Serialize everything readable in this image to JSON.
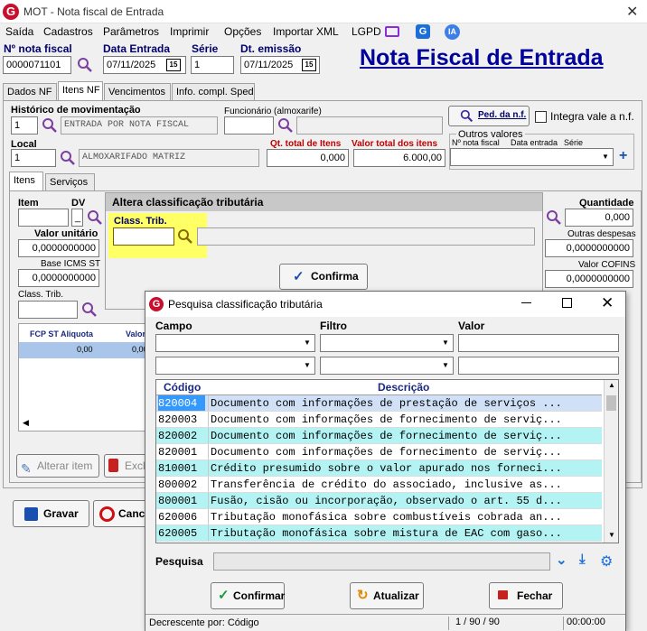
{
  "window": {
    "title": "MOT - Nota fiscal de Entrada",
    "logo_letter": "G"
  },
  "menu": [
    "Saída",
    "Cadastros",
    "Parâmetros",
    "Imprimir",
    "Opções",
    "Importar XML",
    "LGPD"
  ],
  "header": {
    "nota_label": "Nº nota fiscal",
    "nota_value": "0000071101",
    "data_entrada_label": "Data Entrada",
    "data_entrada_value": "07/11/2025",
    "serie_label": "Série",
    "serie_value": "1",
    "emissao_label": "Dt. emissão",
    "emissao_value": "07/11/2025",
    "page_title": "Nota Fiscal de Entrada",
    "calendar_day": "15",
    "ia_badge": "IA"
  },
  "tabs": [
    "Dados NF",
    "Itens NF",
    "Vencimentos",
    "Info. compl. Sped"
  ],
  "itens_nf": {
    "historico_label": "Histórico de movimentação",
    "historico_code": "1",
    "historico_desc": "ENTRADA POR NOTA FISCAL",
    "funcionario_label": "Funcionário (almoxarife)",
    "funcionario_value": "",
    "ped_button": "Ped. da n.f.",
    "integra_label": "Integra vale a n.f.",
    "local_label": "Local",
    "local_code": "1",
    "local_desc": "ALMOXARIFADO MATRIZ",
    "qt_total_label": "Qt. total de Itens",
    "qt_total_value": "0,000",
    "valor_total_label": "Valor total dos itens",
    "valor_total_value": "6.000,00",
    "outros_valores_label": "Outros valores",
    "outros_cols": [
      "Nº nota fiscal",
      "Data entrada",
      "Série"
    ],
    "plus": "+"
  },
  "subtabs": [
    "Itens",
    "Serviços"
  ],
  "item_form": {
    "item_label": "Item",
    "dv_label": "DV",
    "dv_value": "_",
    "valor_unit_label": "Valor unitário",
    "valor_unit_value": "0,0000000000",
    "base_icms_label": "Base ICMS ST",
    "base_icms_value": "0,0000000000",
    "class_trib_label": "Class. Trib.",
    "quantidade_label": "Quantidade",
    "quantidade_value": "0,000",
    "outras_desp_label": "Outras despesas",
    "outras_desp_value": "0,0000000000",
    "valor_cofins_label": "Valor COFINS",
    "valor_cofins_value": "0,0000000000",
    "grid_cols": [
      "FCP ST Aliquota",
      "Valor"
    ],
    "grid_row": [
      "0,00",
      "0,00"
    ],
    "alterar_button": "Alterar item",
    "excluir_button": "Excl"
  },
  "altera_panel": {
    "title": "Altera classificação tributária",
    "class_trib_label": "Class. Trib.",
    "confirma_button": "Confirma"
  },
  "footer": {
    "gravar_button": "Gravar",
    "cancelar_button": "Cance"
  },
  "dialog": {
    "title": "Pesquisa classificação tributária",
    "campo_label": "Campo",
    "filtro_label": "Filtro",
    "valor_label": "Valor",
    "col_codigo": "Código",
    "col_descricao": "Descrição",
    "rows": [
      {
        "codigo": "820004",
        "descricao": "Documento com informações de prestação de serviços ..."
      },
      {
        "codigo": "820003",
        "descricao": "Documento com informações de fornecimento de serviç..."
      },
      {
        "codigo": "820002",
        "descricao": "Documento com informações de fornecimento de serviç..."
      },
      {
        "codigo": "820001",
        "descricao": "Documento com informações de fornecimento de serviç..."
      },
      {
        "codigo": "810001",
        "descricao": "Crédito presumido sobre o valor apurado nos forneci..."
      },
      {
        "codigo": "800002",
        "descricao": "Transferência de crédito do associado, inclusive as..."
      },
      {
        "codigo": "800001",
        "descricao": "Fusão, cisão ou incorporação, observado o art. 55 d..."
      },
      {
        "codigo": "620006",
        "descricao": "Tributação monofásica sobre combustíveis cobrada an..."
      },
      {
        "codigo": "620005",
        "descricao": "Tributação monofásica sobre mistura de EAC com gaso..."
      }
    ],
    "pesquisa_label": "Pesquisa",
    "confirmar_button": "Confirmar",
    "atualizar_button": "Atualizar",
    "fechar_button": "Fechar",
    "status_order": "Decrescente por: Código",
    "status_count": "1 / 90 / 90",
    "status_time": "00:00:00"
  },
  "colors": {
    "accent_blue": "#00009a",
    "highlight_yellow": "#ffff66",
    "row_cyan": "#b4f3f3",
    "selection": "#3399ff"
  }
}
